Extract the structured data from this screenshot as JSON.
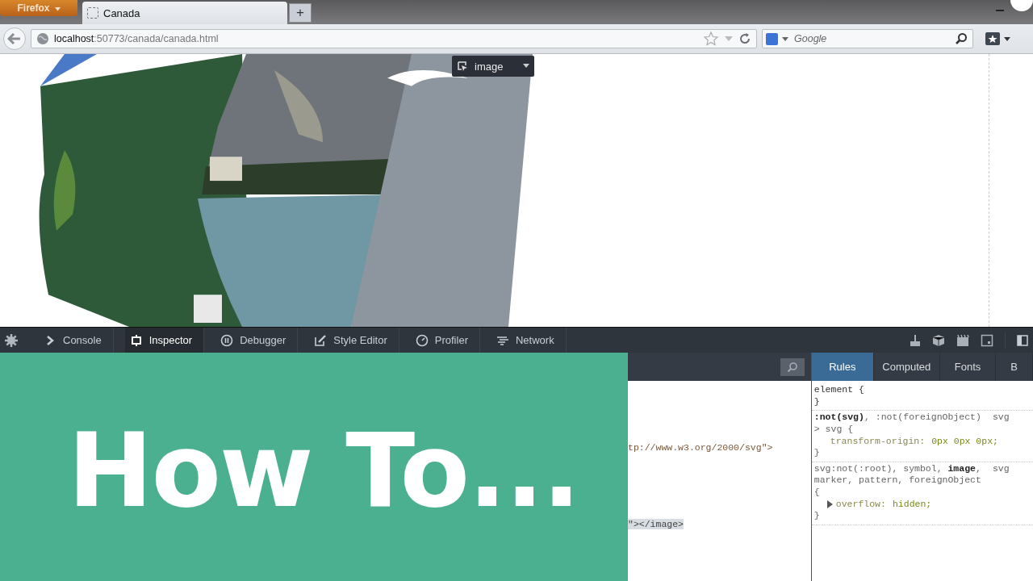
{
  "browser": {
    "menu_button": "Firefox",
    "tabs": [
      {
        "label": "Canada",
        "selected": true
      }
    ],
    "new_tab": "+",
    "url": {
      "host": "localhost",
      "path": ":50773/canada/canada.html"
    },
    "search": {
      "placeholder": "Google"
    }
  },
  "page": {
    "tooltip": "image"
  },
  "devtools": {
    "tools": [
      {
        "label": "Console",
        "selected": false
      },
      {
        "label": "Inspector",
        "selected": true
      },
      {
        "label": "Debugger",
        "selected": false
      },
      {
        "label": "Style Editor",
        "selected": false
      },
      {
        "label": "Profiler",
        "selected": false
      },
      {
        "label": "Network",
        "selected": false
      }
    ],
    "markup": {
      "lines": [
        {
          "text": "tp://www.w3.org/2000/svg\">",
          "selected": false
        },
        {
          "text": "\"></image>",
          "selected": true
        }
      ]
    },
    "sidebar_tabs": [
      {
        "label": "Rules",
        "selected": true
      },
      {
        "label": "Computed",
        "selected": false
      },
      {
        "label": "Fonts",
        "selected": false
      },
      {
        "label": "B",
        "selected": false
      }
    ],
    "rules": [
      {
        "selector_lines": [
          "element {"
        ],
        "close": "}"
      },
      {
        "selector_lines": [
          "**:not(svg)**, :not(foreignObject)",
          "> svg {"
        ],
        "source": "svg",
        "declarations": [
          {
            "property": "transform-origin:",
            "value": "0px 0px 0px;",
            "expandable": false
          }
        ],
        "close": "}"
      },
      {
        "selector_lines": [
          "svg:not(:root), symbol, **image**,",
          "marker, pattern, foreignObject",
          "{"
        ],
        "source": "svg",
        "declarations": [
          {
            "property": "overflow:",
            "value": "hidden;",
            "expandable": true
          }
        ],
        "close": "}"
      }
    ]
  },
  "overlay": {
    "title": "How To..."
  }
}
